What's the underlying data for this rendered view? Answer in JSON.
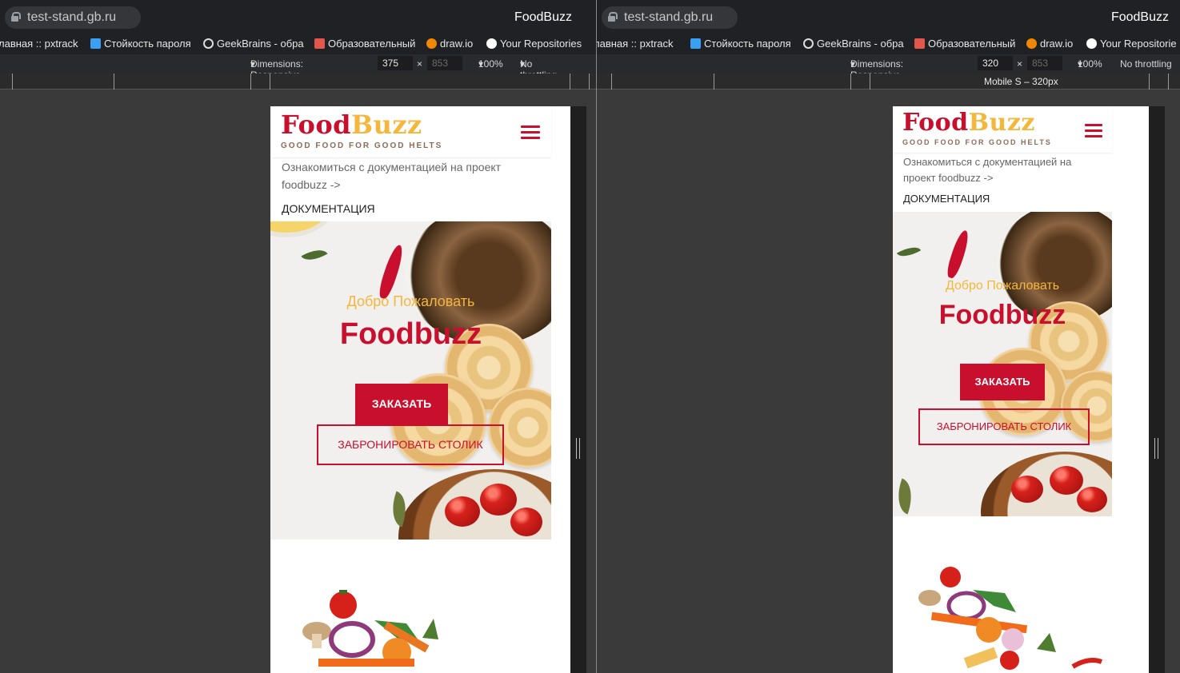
{
  "browser": {
    "url": "test-stand.gb.ru",
    "page_title": "FoodBuzz",
    "bookmarks": [
      "лавная :: pxtrack",
      "Стойкость пароля",
      "GeekBrains - обра",
      "Образовательный",
      "draw.io",
      "Your Repositories"
    ],
    "bookmarks_right": [
      "лавная :: pxtrack",
      "Стойкость пароля",
      "GeekBrains - обра",
      "Образовательный",
      "draw.io",
      "Your Repositorie"
    ]
  },
  "devtools": {
    "left": {
      "dimensions": "Dimensions: Responsive",
      "width": "375",
      "height": "853",
      "zoom": "100%",
      "throttle": "No throttling"
    },
    "right": {
      "dimensions": "Dimensions: Responsive",
      "width": "320",
      "height": "853",
      "zoom": "100%",
      "throttle": "No throttling",
      "media_label": "Mobile S – 320px"
    },
    "times": "×"
  },
  "site": {
    "logo_food": "Food",
    "logo_buzz": "Buzz",
    "tagline": "GOOD FOOD FOR GOOD HELTS",
    "doc_link": "Ознакомиться с документацией на проект foodbuzz ->",
    "doc_heading": "ДОКУМЕНТАЦИЯ",
    "welcome": "Добро Пожаловать",
    "brand": "Foodbuzz",
    "order_button": "ЗАКАЗАТЬ",
    "book_button": "ЗАБРОНИРОВАТЬ СТОЛИК"
  },
  "colors": {
    "brand_red": "#c8102e",
    "brand_yellow": "#f4b63b",
    "tagline_brown": "#8c6a56"
  }
}
